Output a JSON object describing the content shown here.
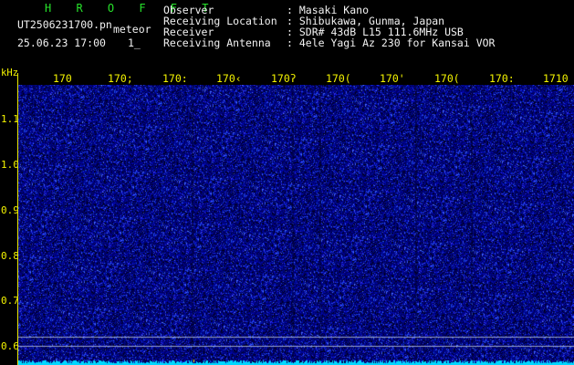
{
  "header": {
    "app_title": "H R O F F T",
    "file_name": "UT2506231700.pn",
    "mode_label": "meteor",
    "timestamp": "25.06.23 17:00",
    "interval": "1_",
    "fields": [
      {
        "label": "Observer",
        "value": ": Masaki Kano"
      },
      {
        "label": "Receiving Location",
        "value": ": Shibukawa, Gunma, Japan"
      },
      {
        "label": "Receiver",
        "value": ": SDR# 43dB L15 111.6MHz USB"
      },
      {
        "label": "Receiving Antenna",
        "value": ": 4ele Yagi Az 230 for Kansai VOR"
      }
    ]
  },
  "axes": {
    "y_unit": "kHz",
    "y_ticks": [
      "1.1",
      "1.0",
      "0.9",
      "0.8",
      "0.7",
      "0.6"
    ],
    "x_ticks": [
      "170",
      "170;",
      "170:",
      "170‹",
      "170ʔ",
      "170(",
      "170'",
      "170(",
      "170:",
      "1710"
    ]
  },
  "colors": {
    "background": "#000000",
    "noise_dark": "#000066",
    "noise_bright": "#3a4cff",
    "baseline": "#00d8ff",
    "axis": "#f4f400",
    "title": "#27e32b"
  }
}
